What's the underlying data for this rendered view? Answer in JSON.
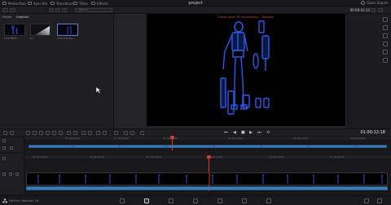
{
  "topbar": {
    "items": [
      {
        "label": "Media Pool",
        "icon": "media-pool-icon"
      },
      {
        "label": "Sync Bin",
        "icon": "sync-bin-icon"
      },
      {
        "label": "Transitions",
        "icon": "transitions-icon"
      },
      {
        "label": "Titles",
        "icon": "titles-icon"
      },
      {
        "label": "Effects",
        "icon": "effects-icon"
      }
    ],
    "project_title": "project",
    "quick_export": "Quick Export"
  },
  "toolbar": {
    "search_placeholder": "Search",
    "timecode": "00:00:01:12"
  },
  "media_pool": {
    "tabs": [
      "Master",
      "Graphics"
    ],
    "clips": [
      {
        "label": "Cine 4854..."
      },
      {
        "label": "Cl..."
      },
      {
        "label": "Fusion Comp..."
      }
    ]
  },
  "viewer": {
    "caption": "Fusion page 3D visualization - Skeleton",
    "accent": "#2f5fff"
  },
  "transport": {
    "timecode": "01:00:12:18"
  },
  "timeline": {
    "ruler_labels": [
      "01:00:00:00",
      "01:00:04:00",
      "01:00:08:00",
      "01:00:12:00",
      "01:00:16:00",
      "01:00:20:00",
      "01:00:24:00"
    ],
    "playhead_color": "#d23b34",
    "clip_color": "#3b78b5"
  },
  "bottombar": {
    "app_name": "DaVinci Resolve 16",
    "pages": [
      "media-icon",
      "cut-icon",
      "edit-icon",
      "fusion-icon",
      "color-icon",
      "fairlight-icon",
      "deliver-icon"
    ]
  }
}
